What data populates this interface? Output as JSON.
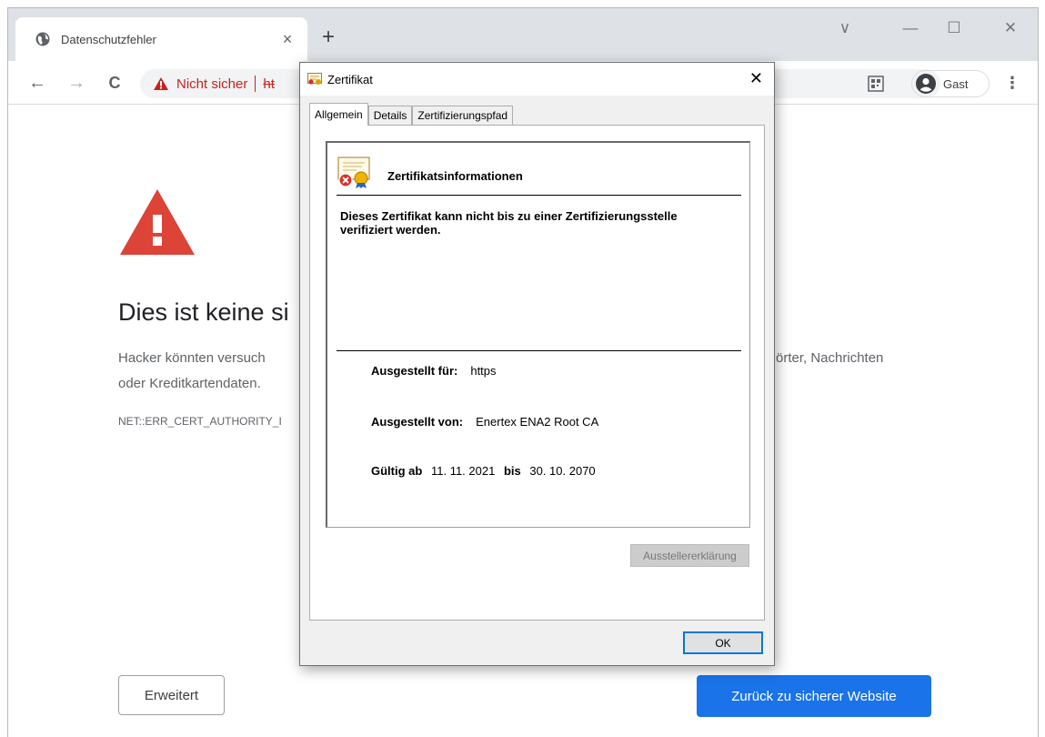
{
  "browser": {
    "tab": {
      "title": "Datenschutzfehler",
      "close_glyph": "×"
    },
    "new_tab_glyph": "+",
    "window_controls": {
      "tabsearch": "∨",
      "minimize": "—",
      "maximize": "☐",
      "close": "✕"
    },
    "nav": {
      "back": "←",
      "forward": "→",
      "reload": "C"
    },
    "omnibox": {
      "security_label": "Nicht sicher",
      "url": "ht"
    },
    "profile": {
      "label": "Gast"
    },
    "menu_glyph": "⋮"
  },
  "page": {
    "heading": "Dies ist keine si",
    "paragraph_line1_start": "Hacker könnten versuch",
    "paragraph_line1_end": "örter, Nachrichten",
    "paragraph_line2": "oder Kreditkartendaten.",
    "error_code": "NET::ERR_CERT_AUTHORITY_I",
    "advanced_button": "Erweitert",
    "back_button": "Zurück zu sicherer Website",
    "colors": {
      "primary": "#1a73e8",
      "danger": "#db4437",
      "omnibox_warning": "#c5221f"
    }
  },
  "dialog": {
    "title": "Zertifikat",
    "close_glyph": "✕",
    "tabs": [
      {
        "label": "Allgemein",
        "active": true
      },
      {
        "label": "Details",
        "active": false
      },
      {
        "label": "Zertifizierungspfad",
        "active": false
      }
    ],
    "cert_title": "Zertifikatsinformationen",
    "message": "Dieses Zertifikat kann nicht bis zu einer Zertifizierungsstelle verifiziert werden.",
    "issued_to_label": "Ausgestellt für:",
    "issued_to_value": "https",
    "issued_by_label": "Ausgestellt von:",
    "issued_by_value": "Enertex ENA2 Root CA",
    "valid_from_label": "Gültig ab",
    "valid_from_value": "11. 11. 2021",
    "valid_to_label": "bis",
    "valid_to_value": "30. 10. 2070",
    "issuer_statement_button": "Ausstellererklärung",
    "ok_button": "OK"
  }
}
